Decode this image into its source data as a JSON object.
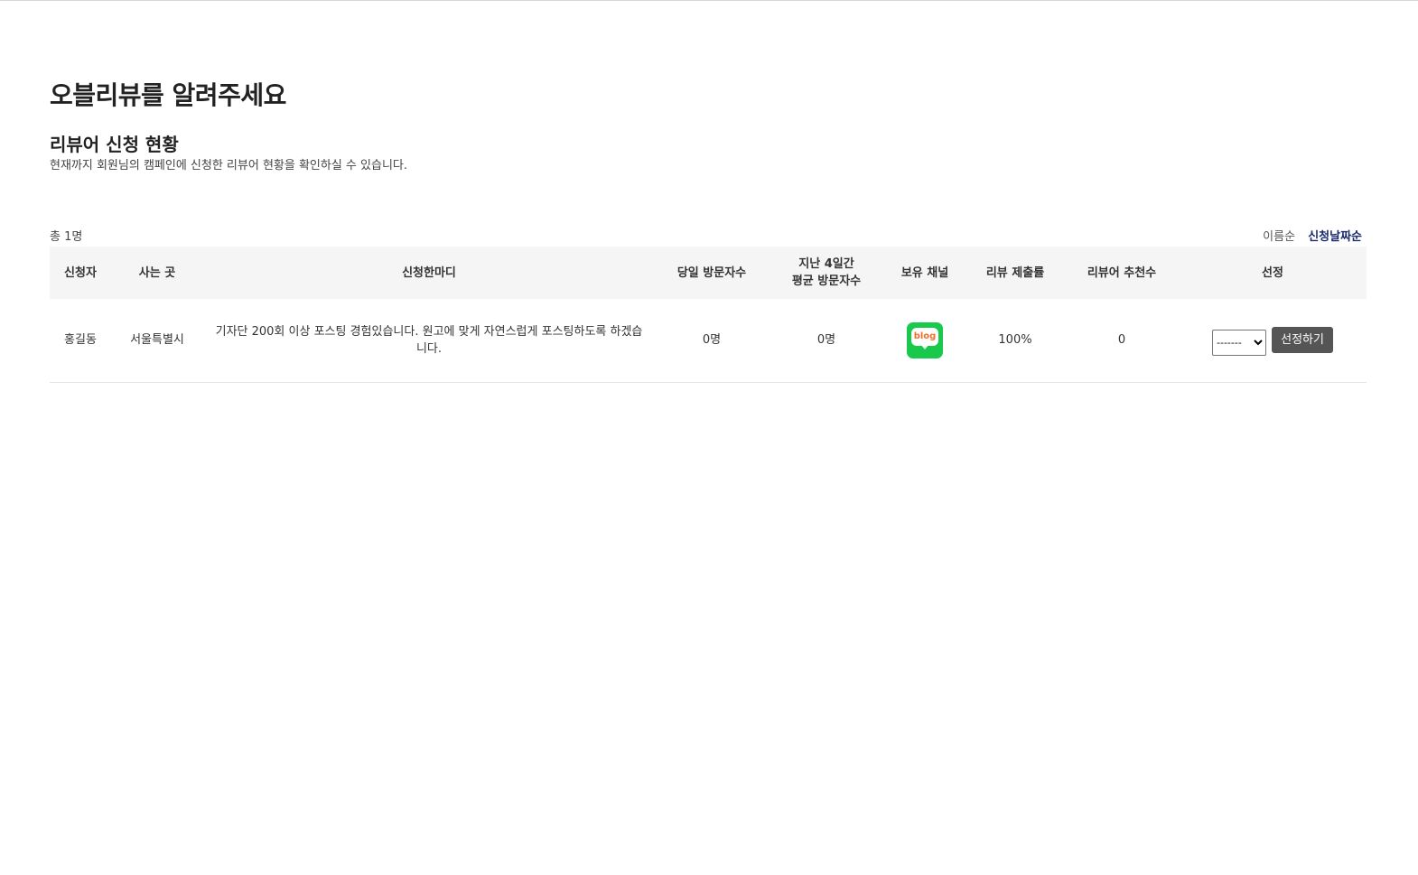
{
  "page": {
    "title": "오블리뷰를 알려주세요",
    "section_title": "리뷰어 신청 현황",
    "section_desc": "현재까지 회원님의 캠페인에 신청한 리뷰어 현황을 확인하실 수 있습니다."
  },
  "summary": {
    "total": "총 1명",
    "sort_name": "이름순",
    "sort_date": "신청날짜순"
  },
  "table": {
    "headers": {
      "applicant": "신청자",
      "location": "사는 곳",
      "comment": "신청한마디",
      "today_visitors": "당일 방문자수",
      "avg_visitors_line1": "지난 4일간",
      "avg_visitors_line2": "평균 방문자수",
      "channel": "보유 채널",
      "submission_rate": "리뷰 제출률",
      "recommend": "리뷰어 추천수",
      "select": "선정"
    },
    "rows": [
      {
        "applicant": "홍길동",
        "location": "서울특별시",
        "comment": "기자단 200회 이상 포스팅 경험있습니다. 원고에 맞게 자연스럽게 포스팅하도록 하겠습니다.",
        "today_visitors": "0명",
        "avg_visitors": "0명",
        "channel_icon": "blog-icon",
        "channel_label": "blog",
        "submission_rate": "100%",
        "recommend": "0",
        "select_value": "-------",
        "select_button": "선정하기"
      }
    ]
  },
  "colors": {
    "header_bg": "#f5f5f5",
    "sort_active": "#1b2a6b",
    "blog_green": "#19c94c",
    "blog_text": "#f0702a",
    "button_bg": "#555555"
  }
}
